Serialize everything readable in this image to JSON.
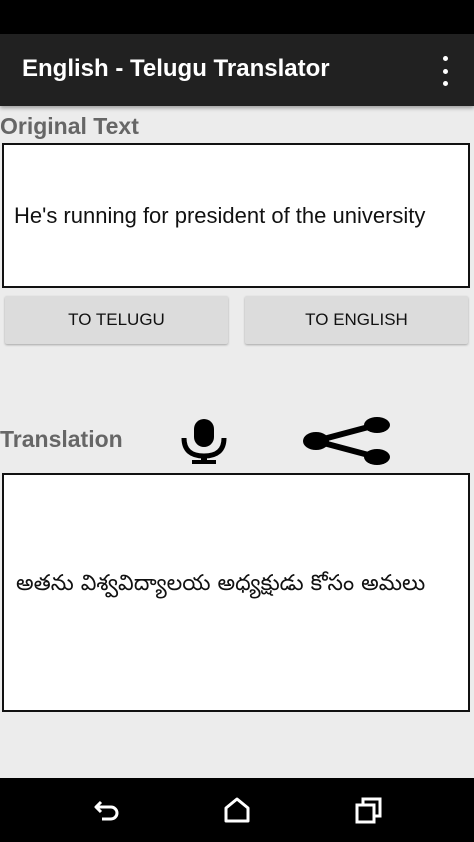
{
  "app": {
    "title": "English - Telugu Translator"
  },
  "original": {
    "label": "Original Text",
    "text": "He's running for president of the university"
  },
  "buttons": {
    "to_telugu": "TO TELUGU",
    "to_english": "TO ENGLISH"
  },
  "translation": {
    "label": "Translation",
    "text": "అతను విశ్వవిద్యాలయ అధ్యక్షుడు కోసం అమలు"
  },
  "icons": {
    "overflow": "more-vert-icon",
    "mic": "microphone-icon",
    "share": "share-icon",
    "back": "back-icon",
    "home": "home-icon",
    "recents": "recents-icon"
  },
  "colors": {
    "appbar": "#212121",
    "background": "#ececec",
    "label": "#666666",
    "button": "#dcdcdc"
  }
}
